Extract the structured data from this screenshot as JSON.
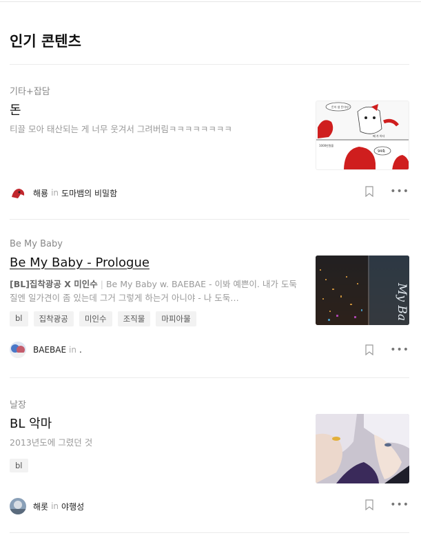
{
  "page_title": "인기 콘텐츠",
  "cards": [
    {
      "category": "기타+잡담",
      "title": "돈",
      "desc": "티끌 모아 태산되는 게 너무 웃겨서 그려버림ㅋㅋㅋㅋㅋㅋㅋㅋ",
      "tags": [],
      "author": "해룡",
      "in": "in",
      "magazine": "도마뱀의 비밀함",
      "thumb_text": [
        "돈이 생 돈이다!",
        "1000만원을",
        "떼 가 아다",
        "94축"
      ]
    },
    {
      "category": "Be My Baby",
      "title": "Be My Baby - Prologue",
      "desc_bold": "[BL]집착광공 X 미인수",
      "desc": "Be My Baby w. BAEBAE - 이봐 예쁜이. 내가 도둑질엔 일가견이 좀 있는데 그거 그렇게 하는거 아니야 - 나 도둑…",
      "tags": [
        "bl",
        "집착광공",
        "미인수",
        "조직물",
        "마피아물"
      ],
      "author": "BAEBAE",
      "in": "in",
      "magazine": ".",
      "thumb_text": "My Ba"
    },
    {
      "category": "날장",
      "title": "BL 악마",
      "desc": "2013년도에 그렸던 것",
      "tags": [
        "bl"
      ],
      "author": "해롯",
      "in": "in",
      "magazine": "야행성"
    }
  ]
}
